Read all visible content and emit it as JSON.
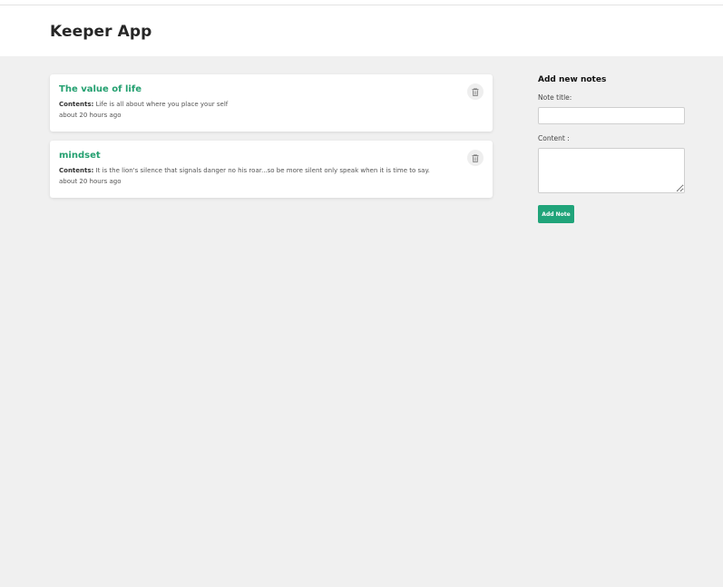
{
  "header": {
    "title": "Keeper App"
  },
  "notes": [
    {
      "title": "The value of life",
      "contents_label": "Contents:",
      "contents": "Life is all about where you place your self",
      "time": "about 20 hours ago"
    },
    {
      "title": "mindset",
      "contents_label": "Contents:",
      "contents": "It is the lion's silence that signals danger no his roar...so be more silent only speak when it is time to say.",
      "time": "about 20 hours ago"
    }
  ],
  "form": {
    "heading": "Add new notes",
    "title_label": "Note title:",
    "title_value": "",
    "content_label": "Content :",
    "content_value": "",
    "submit_label": "Add Note"
  },
  "colors": {
    "accent": "#20a47a",
    "note_title": "#24a070",
    "background": "#f0f0f0"
  },
  "icons": {
    "delete": "trash-icon"
  }
}
